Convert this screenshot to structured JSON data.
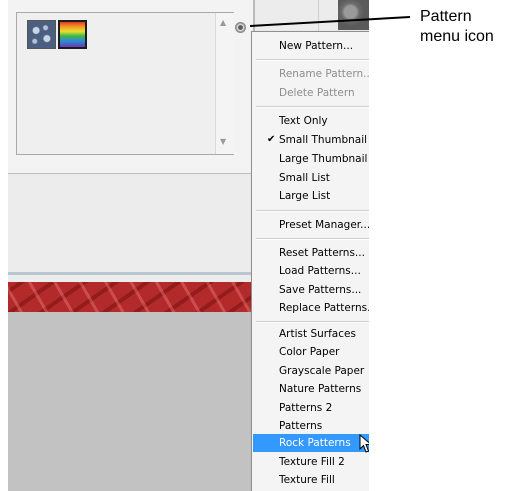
{
  "callout": {
    "line1": "Pattern",
    "line2": "menu icon"
  },
  "icons": {
    "menu": "gear-icon",
    "check": "check-icon",
    "cursor": "cursor-icon",
    "scroll_up": "scroll-up-icon",
    "scroll_down": "scroll-down-icon"
  },
  "colors": {
    "highlight": "#3399ff",
    "menu_bg": "#f4f4f4",
    "disabled_text": "#8d8d8d",
    "red_band": "#b22a2a",
    "workspace_gray": "#c2c2c2"
  },
  "picker": {
    "swatches": [
      "rock-pattern-swatch",
      "rainbow-pattern-swatch"
    ]
  },
  "menu": {
    "new_pattern": "New Pattern...",
    "rename_pattern": "Rename Pattern...",
    "delete_pattern": "Delete Pattern",
    "text_only": "Text Only",
    "check_mark": "✔",
    "small_thumbnail": "Small Thumbnail",
    "large_thumbnail": "Large Thumbnail",
    "small_list": "Small List",
    "large_list": "Large List",
    "preset_manager": "Preset Manager...",
    "reset_patterns": "Reset Patterns...",
    "load_patterns": "Load Patterns...",
    "save_patterns": "Save Patterns...",
    "replace_patterns": "Replace Patterns...",
    "libraries": [
      "Artist Surfaces",
      "Color Paper",
      "Grayscale Paper",
      "Nature Patterns",
      "Patterns 2",
      "Patterns",
      "Rock Patterns",
      "Texture Fill 2",
      "Texture Fill"
    ],
    "selected_view": "Small Thumbnail",
    "hovered_item": "Rock Patterns"
  }
}
